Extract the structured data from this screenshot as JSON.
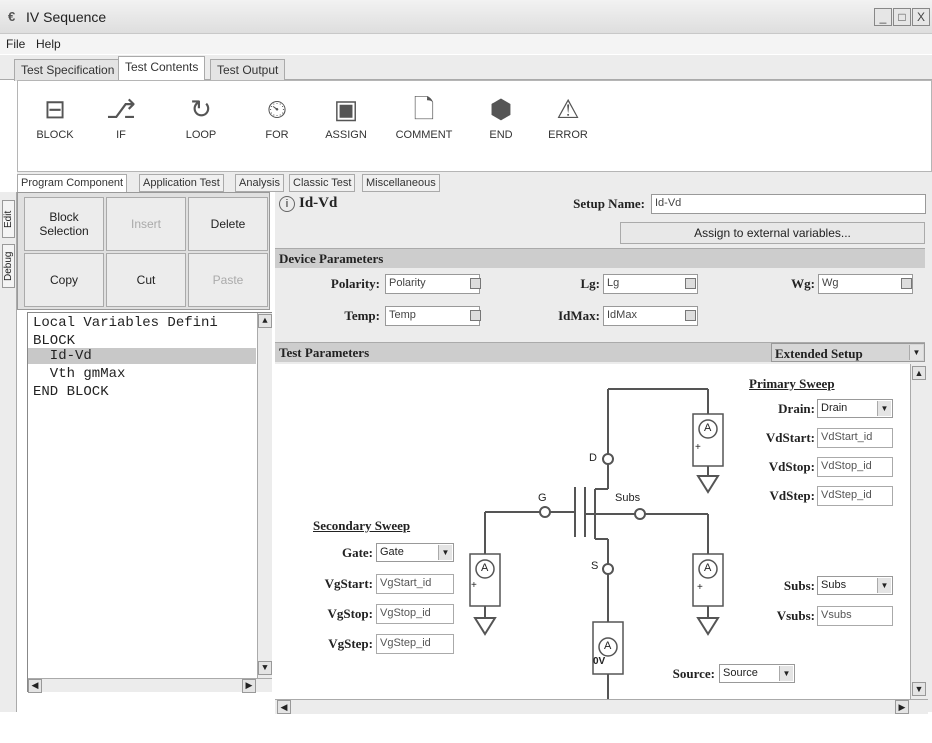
{
  "window": {
    "title": "IV Sequence",
    "min": "_",
    "max": "□",
    "close": "X"
  },
  "menu": [
    "File",
    "Help"
  ],
  "main_tabs": [
    "Test Specification",
    "Test Contents",
    "Test Output"
  ],
  "tools": [
    {
      "label": "BLOCK",
      "icon": "block-icon",
      "glyph": "⊟"
    },
    {
      "label": "IF",
      "icon": "if-icon",
      "glyph": "⎇"
    },
    {
      "label": "LOOP",
      "icon": "loop-icon",
      "glyph": "↻"
    },
    {
      "label": "FOR",
      "icon": "for-icon",
      "glyph": "⏲"
    },
    {
      "label": "ASSIGN",
      "icon": "assign-icon",
      "glyph": "▣"
    },
    {
      "label": "COMMENT",
      "icon": "comment-icon",
      "glyph": "🗋"
    },
    {
      "label": "END",
      "icon": "end-icon",
      "glyph": "⬢"
    },
    {
      "label": "ERROR",
      "icon": "error-icon",
      "glyph": "⚠"
    }
  ],
  "sub_tabs": [
    "Program Component",
    "Application Test",
    "Analysis",
    "Classic Test",
    "Miscellaneous"
  ],
  "side_tabs": [
    "Edit",
    "Debug"
  ],
  "buttons": {
    "block_selection": "Block Selection",
    "insert": "Insert",
    "delete": "Delete",
    "copy": "Copy",
    "cut": "Cut",
    "paste": "Paste"
  },
  "tree": [
    "Local Variables Defini",
    "BLOCK",
    "  Id-Vd",
    "  Vth gmMax",
    "END BLOCK"
  ],
  "setup": {
    "info_title": "Id-Vd",
    "setup_name_label": "Setup Name:",
    "setup_name_value": "Id-Vd",
    "assign_button": "Assign to external variables..."
  },
  "device": {
    "header": "Device Parameters",
    "polarity_label": "Polarity:",
    "polarity_value": "Polarity",
    "lg_label": "Lg:",
    "lg_value": "Lg",
    "wg_label": "Wg:",
    "wg_value": "Wg",
    "temp_label": "Temp:",
    "temp_value": "Temp",
    "idmax_label": "IdMax:",
    "idmax_value": "IdMax"
  },
  "test": {
    "header": "Test Parameters",
    "extended": "Extended Setup"
  },
  "primary": {
    "title": "Primary Sweep",
    "drain_label": "Drain:",
    "drain_value": "Drain",
    "vdstart_label": "VdStart:",
    "vdstart_value": "VdStart_id",
    "vdstop_label": "VdStop:",
    "vdstop_value": "VdStop_id",
    "vdstep_label": "VdStep:",
    "vdstep_value": "VdStep_id"
  },
  "secondary": {
    "title": "Secondary Sweep",
    "gate_label": "Gate:",
    "gate_value": "Gate",
    "vgstart_label": "VgStart:",
    "vgstart_value": "VgStart_id",
    "vgstop_label": "VgStop:",
    "vgstop_value": "VgStop_id",
    "vgstep_label": "VgStep:",
    "vgstep_value": "VgStep_id"
  },
  "subs": {
    "subs_label": "Subs:",
    "subs_value": "Subs",
    "vsubs_label": "Vsubs:",
    "vsubs_value": "Vsubs"
  },
  "source": {
    "label": "Source:",
    "value": "Source"
  },
  "circuit": {
    "d": "D",
    "g": "G",
    "s": "S",
    "subs": "Subs",
    "ammeter": "A",
    "ov": "0V",
    "plus": "+"
  }
}
